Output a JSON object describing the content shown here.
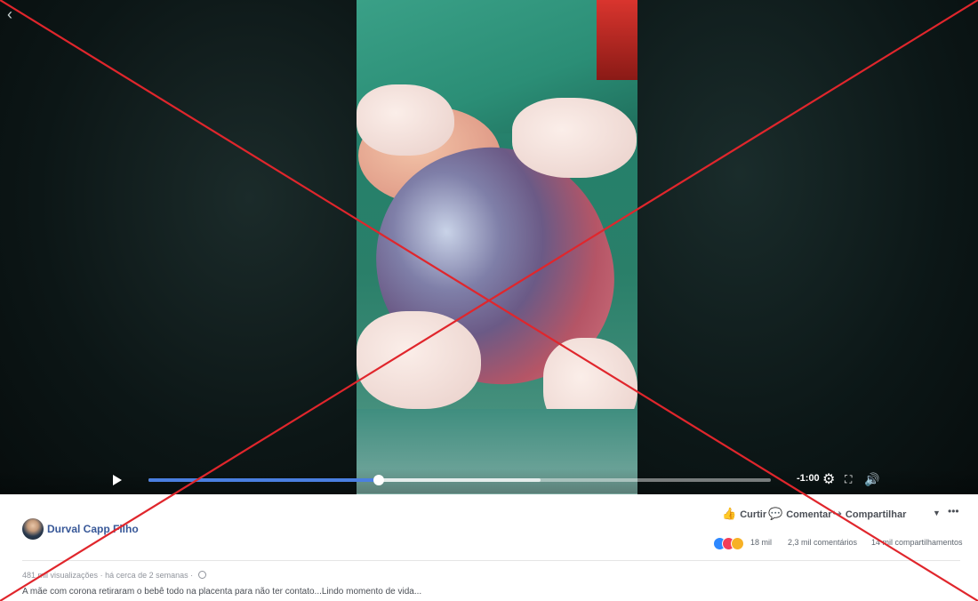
{
  "video": {
    "back_icon": "chevron-left-icon",
    "time_remaining": "-1:00",
    "progress_fraction": 0.37,
    "buffered_fraction": 0.63,
    "icons": {
      "play": "play-icon",
      "settings": "gear-icon",
      "fullscreen": "fullscreen-icon",
      "volume": "speaker-icon"
    }
  },
  "post": {
    "author": "Durval Capp Filho",
    "actions": {
      "like": "Curtir",
      "comment": "Comentar",
      "share": "Compartilhar"
    },
    "stats": {
      "reactions": "18 mil",
      "comments": "2,3 mil comentários",
      "shares": "14 mil compartilhamentos"
    },
    "meta": {
      "views": "481 mil visualizações",
      "time": "há cerca de 2 semanas",
      "separator": "·"
    },
    "caption": "A mãe com corona retiraram o bebê todo na placenta para não ter contato...Lindo momento de vida..."
  },
  "colors": {
    "progress": "#4a7fe0",
    "link": "#385898",
    "cross": "#e0262c"
  }
}
